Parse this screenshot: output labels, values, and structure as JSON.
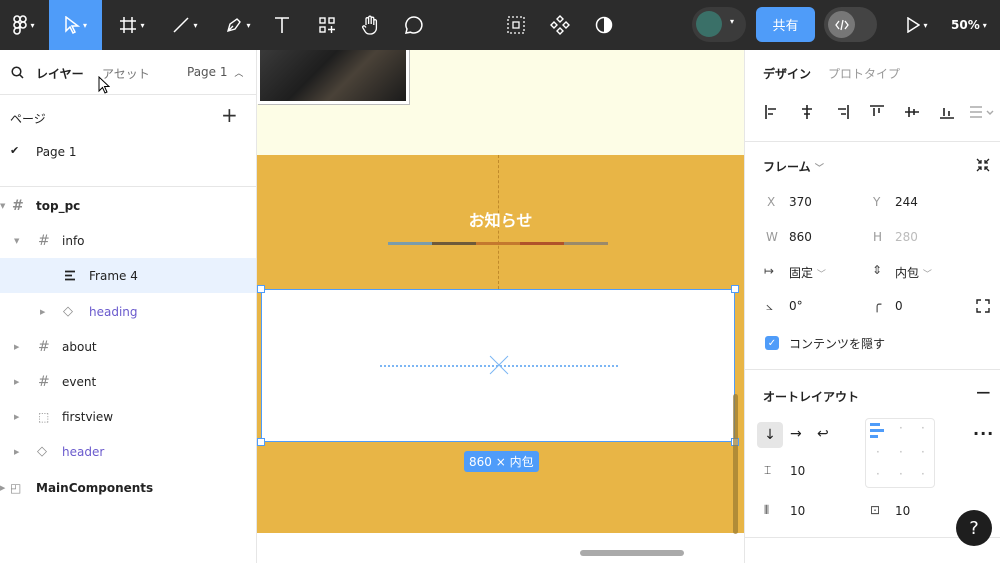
{
  "toolbar": {
    "share_label": "共有",
    "zoom": "50%"
  },
  "left_panel": {
    "tab_layers": "レイヤー",
    "tab_assets": "アセット",
    "page_selector": "Page 1",
    "pages_title": "ページ",
    "pages": [
      "Page 1"
    ],
    "layers": [
      {
        "name": "top_pc"
      },
      {
        "name": "info"
      },
      {
        "name": "Frame 4"
      },
      {
        "name": "heading"
      },
      {
        "name": "about"
      },
      {
        "name": "event"
      },
      {
        "name": "firstview"
      },
      {
        "name": "header"
      },
      {
        "name": "MainComponents"
      }
    ]
  },
  "canvas": {
    "heading_text": "お知らせ",
    "dimension_badge": "860 × 内包"
  },
  "right_panel": {
    "tab_design": "デザイン",
    "tab_prototype": "プロトタイプ",
    "frame_title": "フレーム",
    "x_label": "X",
    "x_value": "370",
    "y_label": "Y",
    "y_value": "244",
    "w_label": "W",
    "w_value": "860",
    "h_label": "H",
    "h_value": "280",
    "width_mode": "固定",
    "height_mode": "内包",
    "rotation": "0°",
    "radius": "0",
    "clip_content": "コンテンツを隠す",
    "autolayout_title": "オートレイアウト",
    "gap": "10",
    "padding_h": "10",
    "padding_v": "10"
  },
  "help_label": "?",
  "colors": {
    "accent": "#4f9cf9",
    "section_bg": "#e8b546",
    "toolbar_bg": "#2c2c2c"
  }
}
